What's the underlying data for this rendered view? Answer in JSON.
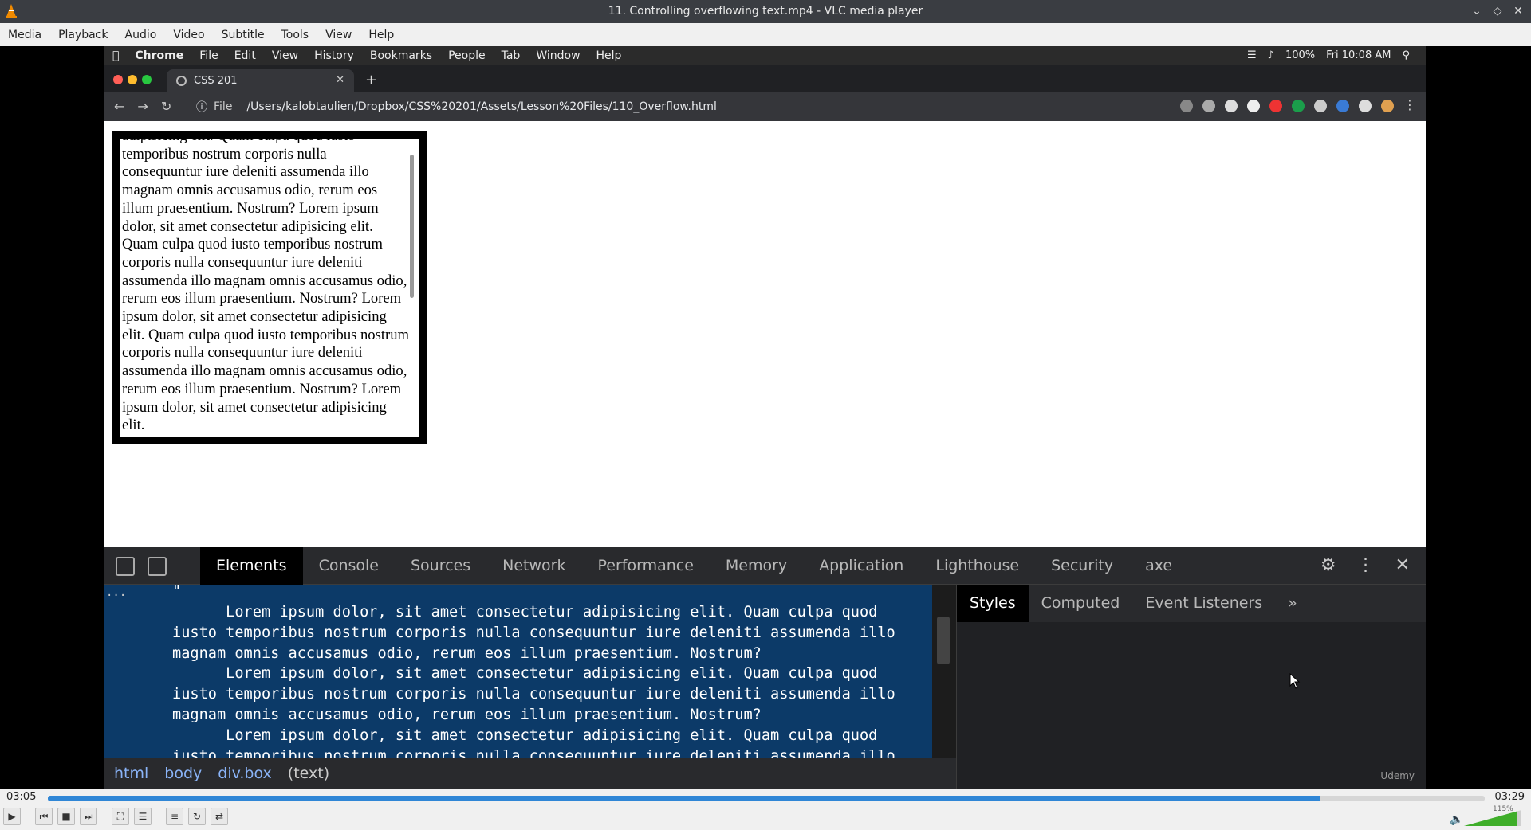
{
  "window": {
    "title": "11. Controlling overflowing text.mp4 - VLC media player"
  },
  "menu": [
    "Media",
    "Playback",
    "Audio",
    "Video",
    "Subtitle",
    "Tools",
    "View",
    "Help"
  ],
  "mac_menu": {
    "apple": "",
    "items": [
      "Chrome",
      "File",
      "Edit",
      "View",
      "History",
      "Bookmarks",
      "People",
      "Tab",
      "Window",
      "Help"
    ],
    "battery": "100%",
    "clock": "Fri 10:08 AM"
  },
  "chrome": {
    "tab_title": "CSS 201",
    "file_label": "File",
    "path": "/Users/kalobtaulien/Dropbox/CSS%20201/Assets/Lesson%20Files/110_Overflow.html"
  },
  "box_text": "adipisicing elit. Quam culpa quod iusto temporibus nostrum corporis nulla consequuntur iure deleniti assumenda illo magnam omnis accusamus odio, rerum eos illum praesentium. Nostrum? Lorem ipsum dolor, sit amet consectetur adipisicing elit. Quam culpa quod iusto temporibus nostrum corporis nulla consequuntur iure deleniti assumenda illo magnam omnis accusamus odio, rerum eos illum praesentium. Nostrum? Lorem ipsum dolor, sit amet consectetur adipisicing elit. Quam culpa quod iusto temporibus nostrum corporis nulla consequuntur iure deleniti assumenda illo magnam omnis accusamus odio, rerum eos illum praesentium. Nostrum? Lorem ipsum dolor, sit amet consectetur adipisicing elit.",
  "devtools": {
    "tabs": [
      "Elements",
      "Console",
      "Sources",
      "Network",
      "Performance",
      "Memory",
      "Application",
      "Lighthouse",
      "Security",
      "axe"
    ],
    "active_tab": "Elements",
    "elements_dots": "...",
    "elements_quote": "\"",
    "code": "      Lorem ipsum dolor, sit amet consectetur adipisicing elit. Quam culpa quod\niusto temporibus nostrum corporis nulla consequuntur iure deleniti assumenda illo\nmagnam omnis accusamus odio, rerum eos illum praesentium. Nostrum?\n      Lorem ipsum dolor, sit amet consectetur adipisicing elit. Quam culpa quod\niusto temporibus nostrum corporis nulla consequuntur iure deleniti assumenda illo\nmagnam omnis accusamus odio, rerum eos illum praesentium. Nostrum?\n      Lorem ipsum dolor, sit amet consectetur adipisicing elit. Quam culpa quod\niusto temporibus nostrum corporis nulla consequuntur iure deleniti assumenda illo",
    "breadcrumbs": [
      "html",
      "body",
      "div.box",
      "(text)"
    ],
    "styles_tabs": [
      "Styles",
      "Computed",
      "Event Listeners",
      "»"
    ],
    "watermark": "Udemy"
  },
  "player": {
    "elapsed": "03:05",
    "total": "03:29",
    "progress": 0.885,
    "volume_label": "115%",
    "volume": 1.15
  },
  "colors": {
    "seek_fill": "#2f86d6",
    "devtools_selection": "#0c3a68"
  }
}
